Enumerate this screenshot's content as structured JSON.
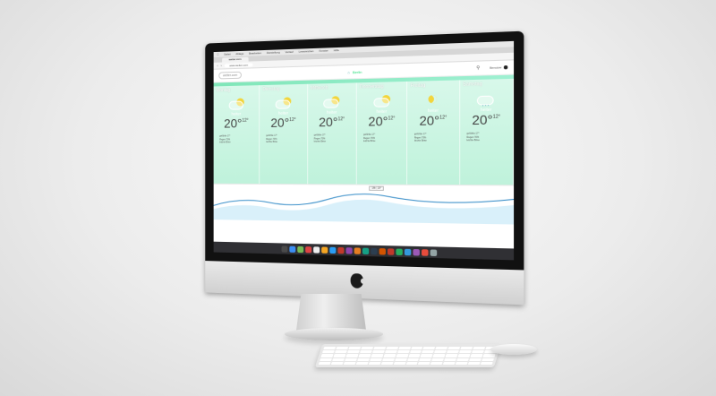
{
  "browser": {
    "menu": [
      "Safari",
      "Ablage",
      "Bearbeiten",
      "Darstellung",
      "Verlauf",
      "Lesezeichen",
      "Fenster",
      "Hilfe"
    ],
    "tab_label": "wetter.com",
    "url": "www.wetter.com"
  },
  "app": {
    "logo": "wetter.com",
    "location_prefix": "⌂",
    "city": "Berlin",
    "user": "Benutzer"
  },
  "days": [
    {
      "name": "Montag",
      "desc": "heiter",
      "hi": "20°",
      "lo": "12°",
      "icon": "sun-cloud",
      "details": [
        "gefühlte 17°",
        "Regen 70%",
        "leichte Brise"
      ]
    },
    {
      "name": "Dienstag",
      "desc": "heiter",
      "hi": "20°",
      "lo": "12°",
      "icon": "sun-cloud",
      "details": [
        "gefühlte 17°",
        "Regen 70%",
        "leichte Brise"
      ]
    },
    {
      "name": "Mittwoch",
      "desc": "heiter",
      "hi": "20°",
      "lo": "12°",
      "icon": "sun-cloud",
      "details": [
        "gefühlte 17°",
        "Regen 70%",
        "leichte Brise"
      ]
    },
    {
      "name": "Donnerstag",
      "desc": "heiter",
      "hi": "20°",
      "lo": "12°",
      "icon": "sun-cloud",
      "details": [
        "gefühlte 17°",
        "Regen 70%",
        "leichte Brise"
      ]
    },
    {
      "name": "Freitag",
      "desc": "heiter",
      "hi": "20°",
      "lo": "12°",
      "icon": "moon",
      "details": [
        "gefühlte 17°",
        "Regen 70%",
        "leichte Brise"
      ]
    },
    {
      "name": "Samstag",
      "desc": "heiter",
      "hi": "20°",
      "lo": "12°",
      "icon": "snow",
      "details": [
        "gefühlte 17°",
        "Regen 70%",
        "leichte Brise"
      ]
    }
  ],
  "graph_label": "18h | 20°"
}
